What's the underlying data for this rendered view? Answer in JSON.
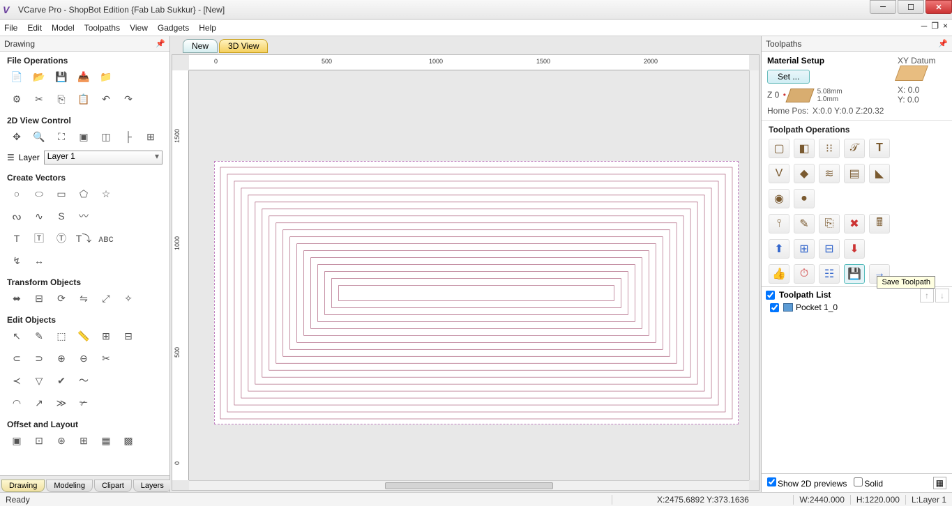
{
  "title": "VCarve Pro - ShopBot Edition {Fab Lab Sukkur} - [New]",
  "menu": [
    "File",
    "Edit",
    "Model",
    "Toolpaths",
    "View",
    "Gadgets",
    "Help"
  ],
  "leftPanel": {
    "header": "Drawing",
    "sections": {
      "file_ops": "File Operations",
      "view2d": "2D View Control",
      "layer_label": "Layer",
      "layer_value": "Layer 1",
      "create_vec": "Create Vectors",
      "transform": "Transform Objects",
      "edit": "Edit Objects",
      "offset": "Offset and Layout"
    }
  },
  "viewTabs": {
    "new": "New",
    "td": "3D View"
  },
  "rulerH": [
    "0",
    "500",
    "1000",
    "1500",
    "2000"
  ],
  "rulerV": [
    "0",
    "500",
    "1000",
    "1500"
  ],
  "rightPanel": {
    "header": "Toolpaths",
    "mat_setup": "Material Setup",
    "set_btn": "Set ...",
    "z_label": "Z 0",
    "thick": "5.08mm",
    "gap": "1.0mm",
    "homepos_label": "Home Pos:",
    "homepos": "X:0.0 Y:0.0 Z:20.32",
    "xy_datum": "XY Datum",
    "xy_x": "X: 0.0",
    "xy_y": "Y: 0.0",
    "tp_ops": "Toolpath Operations",
    "tooltip": "Save Toolpath",
    "tp_list": "Toolpath List",
    "tp_item": "Pocket 1_0",
    "show2d": "Show 2D previews",
    "solid": "Solid"
  },
  "bottomTabs": [
    "Drawing",
    "Modeling",
    "Clipart",
    "Layers"
  ],
  "status": {
    "ready": "Ready",
    "coords": "X:2475.6892 Y:373.1636",
    "w": "W:2440.000",
    "h": "H:1220.000",
    "layer": "L:Layer 1"
  }
}
